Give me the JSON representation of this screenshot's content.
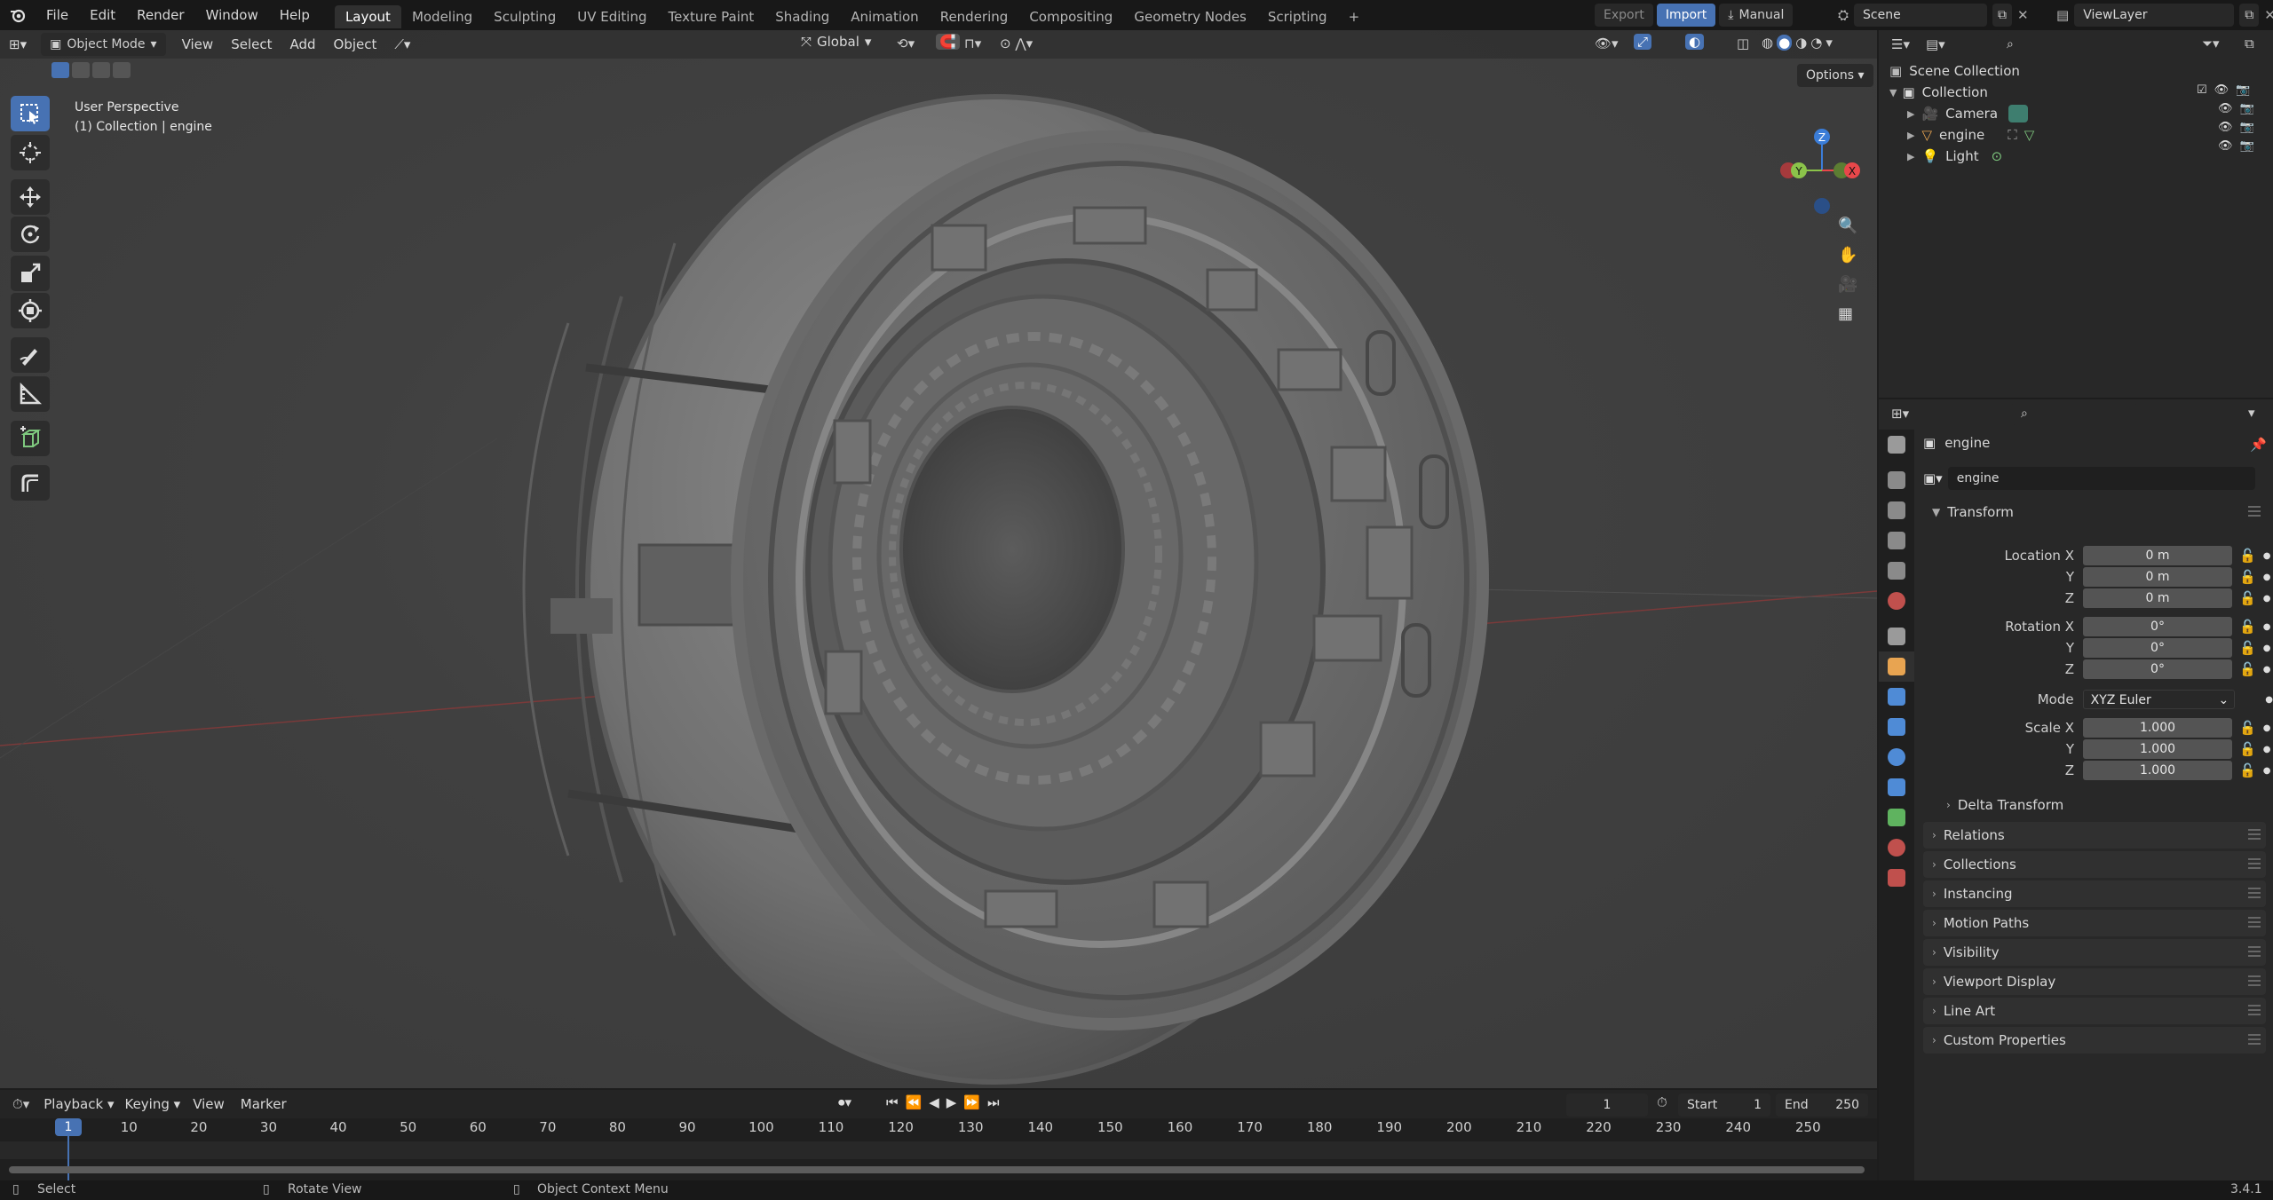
{
  "app": {
    "menus": [
      "File",
      "Edit",
      "Render",
      "Window",
      "Help"
    ],
    "workspaces": [
      "Layout",
      "Modeling",
      "Sculpting",
      "UV Editing",
      "Texture Paint",
      "Shading",
      "Animation",
      "Rendering",
      "Compositing",
      "Geometry Nodes",
      "Scripting"
    ],
    "active_workspace": "Layout",
    "add_tab": "+",
    "export_label": "Export",
    "import_label": "Import",
    "manual_label": "Manual",
    "scene_name": "Scene",
    "view_layer": "ViewLayer"
  },
  "viewport": {
    "mode": "Object Mode",
    "menus": [
      "View",
      "Select",
      "Add",
      "Object"
    ],
    "transform_orientation": "Global",
    "options_label": "Options",
    "overlay_line1": "User Perspective",
    "overlay_line2": "(1) Collection | engine",
    "gizmo": {
      "z": "Z",
      "y": "Y",
      "x": "X"
    },
    "tools": [
      "select-box-tool",
      "cursor-tool",
      "move-tool",
      "rotate-tool",
      "scale-tool",
      "transform-tool",
      "annotate-tool",
      "measure-tool",
      "add-cube-tool",
      "extrude-tool"
    ]
  },
  "outliner": {
    "root": "Scene Collection",
    "collection": "Collection",
    "items": [
      {
        "name": "Camera",
        "icon": "camera-icon",
        "color": "#e8a451"
      },
      {
        "name": "engine",
        "icon": "mesh-icon",
        "color": "#e8a451"
      },
      {
        "name": "Light",
        "icon": "light-icon",
        "color": "#e8a451"
      }
    ]
  },
  "properties": {
    "object_name": "engine",
    "datablock_name": "engine",
    "transform_header": "Transform",
    "location": {
      "label": "Location X",
      "x": "0 m",
      "y": "0 m",
      "z": "0 m"
    },
    "rotation": {
      "label": "Rotation X",
      "x": "0°",
      "y": "0°",
      "z": "0°"
    },
    "mode_label": "Mode",
    "mode_value": "XYZ Euler",
    "scale": {
      "label": "Scale X",
      "x": "1.000",
      "y": "1.000",
      "z": "1.000"
    },
    "axis_y": "Y",
    "axis_z": "Z",
    "delta": "Delta Transform",
    "panels": [
      "Relations",
      "Collections",
      "Instancing",
      "Motion Paths",
      "Visibility",
      "Viewport Display",
      "Line Art",
      "Custom Properties"
    ]
  },
  "timeline": {
    "menus": [
      "Playback",
      "Keying",
      "View",
      "Marker"
    ],
    "current_frame": "1",
    "start_label": "Start",
    "start": "1",
    "end_label": "End",
    "end": "250",
    "ticks": [
      "1",
      "10",
      "20",
      "30",
      "40",
      "50",
      "60",
      "70",
      "80",
      "90",
      "100",
      "110",
      "120",
      "130",
      "140",
      "150",
      "160",
      "170",
      "180",
      "190",
      "200",
      "210",
      "220",
      "230",
      "240",
      "250"
    ]
  },
  "status": {
    "select": "Select",
    "rotate": "Rotate View",
    "context": "Object Context Menu",
    "version": "3.4.1"
  },
  "colors": {
    "accent": "#4772b3",
    "x_axis": "#e8474a",
    "y_axis": "#8bc34a",
    "z_axis": "#3b7dd8"
  }
}
